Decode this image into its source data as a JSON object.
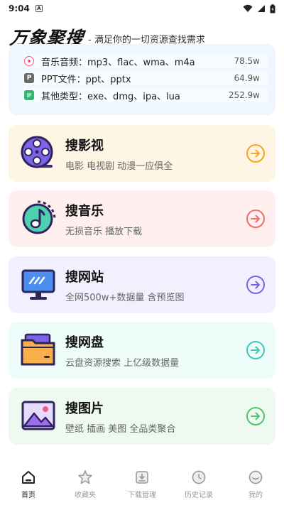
{
  "status_bar": {
    "time": "9:04",
    "notif_letter": "A"
  },
  "header": {
    "logo": "万象聚搜",
    "slogan": "- 满足你的一切资源查找需求"
  },
  "file_types": [
    {
      "label": "音乐音频：mp3、flac、wma、m4a",
      "count": "78.5w",
      "icon": "music-file-icon",
      "color": "#f0588a"
    },
    {
      "label": "PPT文件：ppt、pptx",
      "count": "64.9w",
      "icon": "ppt-file-icon",
      "color": "#6b6b6b"
    },
    {
      "label": "其他类型：exe、dmg、ipa、lua",
      "count": "252.9w",
      "icon": "other-file-icon",
      "color": "#2eb872"
    }
  ],
  "categories": [
    {
      "title": "搜影视",
      "subtitle": "电影 电视剧 动漫一应俱全",
      "icon": "film-reel-icon",
      "bg": "#fff5e4",
      "accent": "#f7a51d"
    },
    {
      "title": "搜音乐",
      "subtitle": "无损音乐 播放下载",
      "icon": "music-note-icon",
      "bg": "#ffefef",
      "accent": "#f0706a"
    },
    {
      "title": "搜网站",
      "subtitle": "全网500w+数据量 含预览图",
      "icon": "monitor-icon",
      "bg": "#f2f0ff",
      "accent": "#7b63e6"
    },
    {
      "title": "搜网盘",
      "subtitle": "云盘资源搜索 上亿级数据量",
      "icon": "folder-icon",
      "bg": "#eefcfa",
      "accent": "#3ec9b6"
    },
    {
      "title": "搜图片",
      "subtitle": "壁纸 插画 美图 全品类聚合",
      "icon": "image-icon",
      "bg": "#eefaf0",
      "accent": "#52c46e"
    }
  ],
  "bottom_nav": [
    {
      "label": "首页",
      "icon": "home-icon",
      "active": true
    },
    {
      "label": "收藏夹",
      "icon": "star-icon",
      "active": false
    },
    {
      "label": "下载管理",
      "icon": "download-icon",
      "active": false
    },
    {
      "label": "历史记录",
      "icon": "history-icon",
      "active": false
    },
    {
      "label": "我的",
      "icon": "profile-icon",
      "active": false
    }
  ]
}
